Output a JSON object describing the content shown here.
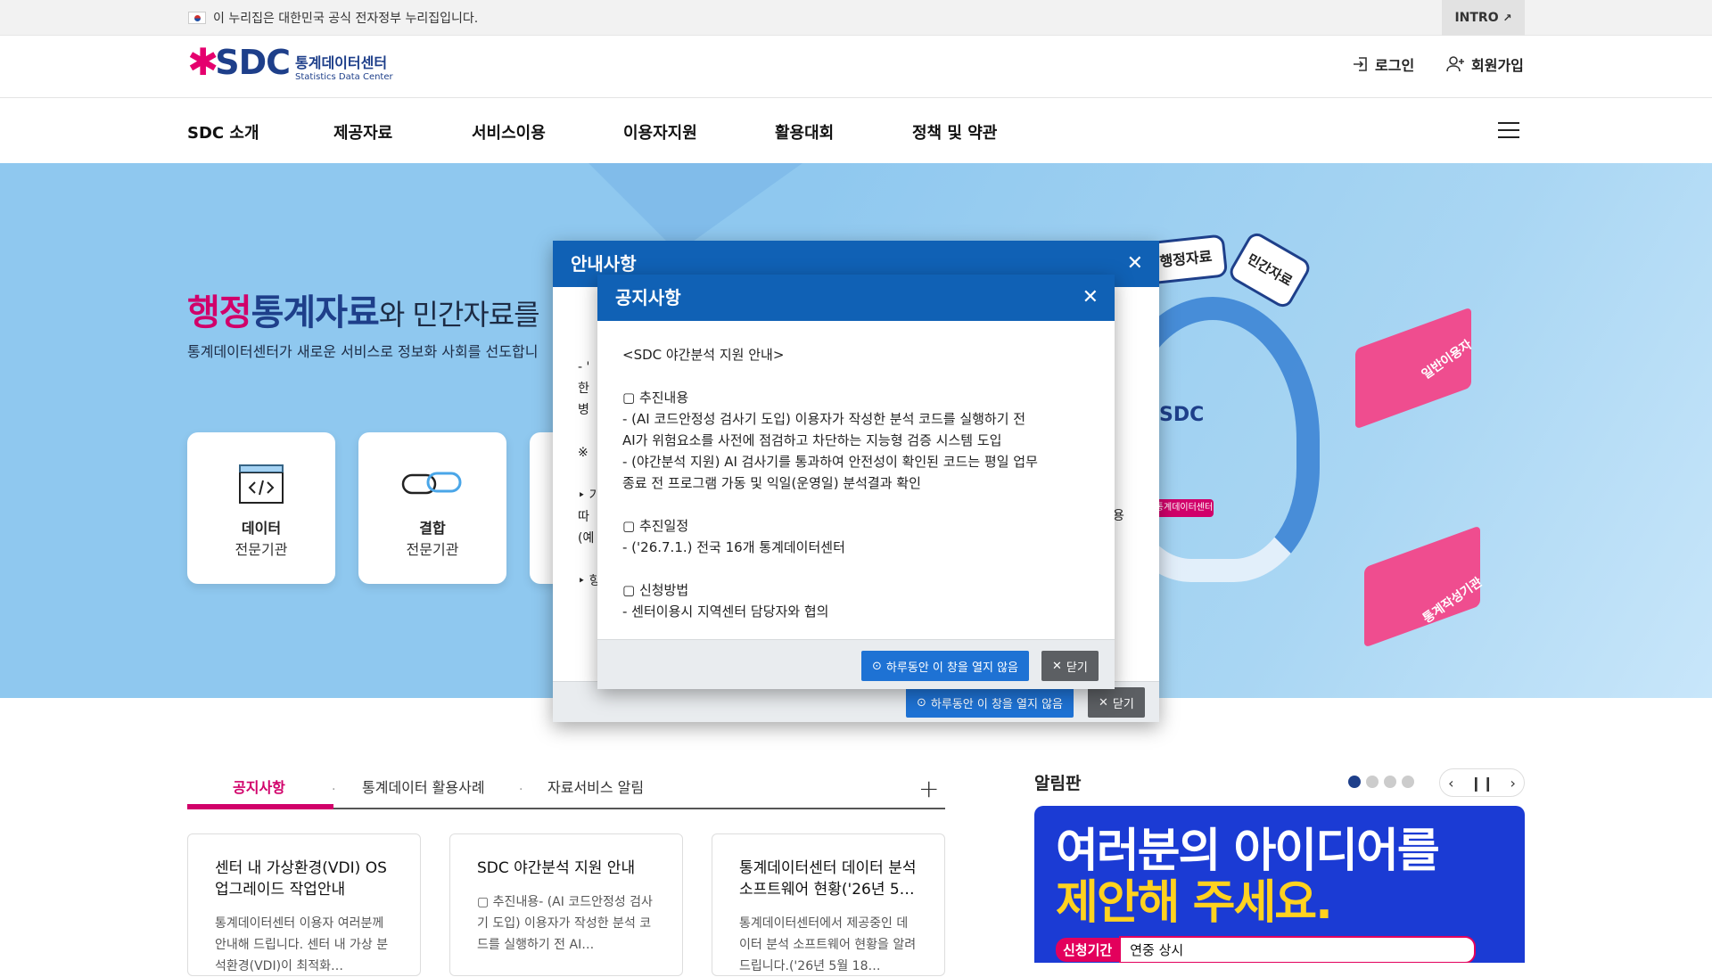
{
  "topbar": {
    "gov_notice": "이 누리집은 대한민국 공식 전자정부 누리집입니다.",
    "intro_label": "INTRO"
  },
  "header": {
    "logo_mark": "SDC",
    "logo_korean": "통계데이터센터",
    "logo_english": "Statistics Data Center",
    "login_label": "로그인",
    "signup_label": "회원가입"
  },
  "nav": {
    "items": [
      "SDC 소개",
      "제공자료",
      "서비스이용",
      "이용자지원",
      "활용대회",
      "정책 및 약관"
    ]
  },
  "hero": {
    "title_part1": "행정",
    "title_part2": "통계자료",
    "title_part3": "와 민간자료를 ",
    "subtitle": "통계데이터센터가 새로운 서비스로 정보화 사회를 선도합니",
    "cards": [
      {
        "line1": "데이터",
        "line2": "전문기관"
      },
      {
        "line1": "결합",
        "line2": "전문기관"
      }
    ],
    "illustration_labels": [
      "행정자료",
      "민간자료",
      "SDC",
      "일반이용자",
      "통계작성기관",
      "통계데이터센터"
    ]
  },
  "modal_back": {
    "title": "안내사항",
    "partial_text": [
      "- '",
      "한",
      "병",
      "※",
      "‣ 가",
      "따",
      "(예",
      "‣ 항"
    ],
    "right_fragment": "용",
    "day_button": "하루동안 이 창을 열지 않음",
    "close_button": "닫기"
  },
  "modal_front": {
    "title": "공지사항",
    "body": "<SDC 야간분석 지원 안내>\n\n▢ 추진내용\n- (AI 코드안정성 검사기 도입) 이용자가 작성한 분석 코드를 실행하기 전 AI가 위험요소를 사전에 점검하고 차단하는 지능형 검증 시스템 도입\n- (야간분석 지원) AI 검사기를 통과하여 안전성이 확인된 코드는 평일 업무 종료 전 프로그램 가동 및 익일(운영일) 분석결과 확인\n\n▢ 추진일정\n- ('26.7.1.) 전국 16개 통계데이터센터\n\n▢ 신청방법\n- 센터이용시 지역센터 담당자와 협의",
    "day_button": "하루동안 이 창을 열지 않음",
    "close_button": "닫기"
  },
  "notice_tabs": {
    "tabs": [
      "공지사항",
      "통계데이터 활용사례",
      "자료서비스 알림"
    ],
    "more": "+",
    "cards": [
      {
        "title": "센터 내 가상환경(VDI) OS 업그레이드 작업안내",
        "body": "통계데이터센터 이용자 여러분께 안내해 드립니다. 센터 내 가상 분석환경(VDI)이 최적화…"
      },
      {
        "title": "SDC 야간분석 지원 안내",
        "body": "▢ 추진내용- (AI 코드안정성 검사기 도입) 이용자가 작성한 분석 코드를 실행하기 전 AI…"
      },
      {
        "title": "통계데이터센터 데이터 분석 소프트웨어 현황('26년 5…",
        "body": "통계데이터센터에서 제공중인 데이터 분석 소프트웨어 현황을 알려 드립니다.('26년 5월 18…"
      }
    ]
  },
  "board": {
    "title": "알림판",
    "banner_line1": "여러분의 아이디어를",
    "banner_line2": "제안해 주세요.",
    "period_label": "신청기간",
    "period_value": "연중 상시"
  },
  "colors": {
    "brand_blue": "#1061b5",
    "accent_pink": "#d1006a",
    "hero_bg": "#8fc8ef"
  }
}
